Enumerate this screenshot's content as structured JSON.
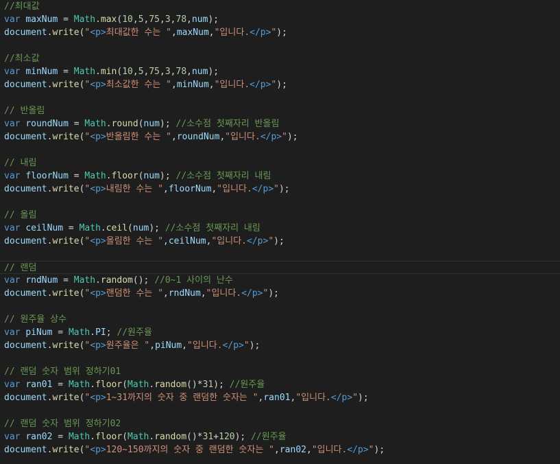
{
  "editor": {
    "current_line": 20,
    "lines": [
      [
        [
          "comment",
          "//최대값"
        ]
      ],
      [
        [
          "keyword",
          "var"
        ],
        [
          "plain",
          " "
        ],
        [
          "variable",
          "maxNum"
        ],
        [
          "plain",
          " = "
        ],
        [
          "class",
          "Math"
        ],
        [
          "plain",
          "."
        ],
        [
          "func",
          "max"
        ],
        [
          "plain",
          "("
        ],
        [
          "number",
          "10"
        ],
        [
          "plain",
          ","
        ],
        [
          "number",
          "5"
        ],
        [
          "plain",
          ","
        ],
        [
          "number",
          "75"
        ],
        [
          "plain",
          ","
        ],
        [
          "number",
          "3"
        ],
        [
          "plain",
          ","
        ],
        [
          "number",
          "78"
        ],
        [
          "plain",
          ","
        ],
        [
          "variable",
          "num"
        ],
        [
          "plain",
          ");"
        ]
      ],
      [
        [
          "variable",
          "document"
        ],
        [
          "plain",
          "."
        ],
        [
          "func",
          "write"
        ],
        [
          "plain",
          "("
        ],
        [
          "string",
          "\""
        ],
        [
          "tag",
          "<p>"
        ],
        [
          "string",
          "최대값한 수는 \""
        ],
        [
          "plain",
          ","
        ],
        [
          "variable",
          "maxNum"
        ],
        [
          "plain",
          ","
        ],
        [
          "string",
          "\"입니다."
        ],
        [
          "tag",
          "</p>"
        ],
        [
          "string",
          "\""
        ],
        [
          "plain",
          ");"
        ]
      ],
      [],
      [
        [
          "comment",
          "//최소값"
        ]
      ],
      [
        [
          "keyword",
          "var"
        ],
        [
          "plain",
          " "
        ],
        [
          "variable",
          "minNum"
        ],
        [
          "plain",
          " = "
        ],
        [
          "class",
          "Math"
        ],
        [
          "plain",
          "."
        ],
        [
          "func",
          "min"
        ],
        [
          "plain",
          "("
        ],
        [
          "number",
          "10"
        ],
        [
          "plain",
          ","
        ],
        [
          "number",
          "5"
        ],
        [
          "plain",
          ","
        ],
        [
          "number",
          "75"
        ],
        [
          "plain",
          ","
        ],
        [
          "number",
          "3"
        ],
        [
          "plain",
          ","
        ],
        [
          "number",
          "78"
        ],
        [
          "plain",
          ","
        ],
        [
          "variable",
          "num"
        ],
        [
          "plain",
          ");"
        ]
      ],
      [
        [
          "variable",
          "document"
        ],
        [
          "plain",
          "."
        ],
        [
          "func",
          "write"
        ],
        [
          "plain",
          "("
        ],
        [
          "string",
          "\""
        ],
        [
          "tag",
          "<p>"
        ],
        [
          "string",
          "최소값한 수는 \""
        ],
        [
          "plain",
          ","
        ],
        [
          "variable",
          "minNum"
        ],
        [
          "plain",
          ","
        ],
        [
          "string",
          "\"입니다."
        ],
        [
          "tag",
          "</p>"
        ],
        [
          "string",
          "\""
        ],
        [
          "plain",
          ");"
        ]
      ],
      [],
      [
        [
          "comment",
          "// 반올림"
        ]
      ],
      [
        [
          "keyword",
          "var"
        ],
        [
          "plain",
          " "
        ],
        [
          "variable",
          "roundNum"
        ],
        [
          "plain",
          " = "
        ],
        [
          "class",
          "Math"
        ],
        [
          "plain",
          "."
        ],
        [
          "func",
          "round"
        ],
        [
          "plain",
          "("
        ],
        [
          "variable",
          "num"
        ],
        [
          "plain",
          "); "
        ],
        [
          "comment",
          "//소수점 첫째자리 반올림"
        ]
      ],
      [
        [
          "variable",
          "document"
        ],
        [
          "plain",
          "."
        ],
        [
          "func",
          "write"
        ],
        [
          "plain",
          "("
        ],
        [
          "string",
          "\""
        ],
        [
          "tag",
          "<p>"
        ],
        [
          "string",
          "반올림한 수는 \""
        ],
        [
          "plain",
          ","
        ],
        [
          "variable",
          "roundNum"
        ],
        [
          "plain",
          ","
        ],
        [
          "string",
          "\"입니다."
        ],
        [
          "tag",
          "</p>"
        ],
        [
          "string",
          "\""
        ],
        [
          "plain",
          ");"
        ]
      ],
      [],
      [
        [
          "comment",
          "// 내림"
        ]
      ],
      [
        [
          "keyword",
          "var"
        ],
        [
          "plain",
          " "
        ],
        [
          "variable",
          "floorNum"
        ],
        [
          "plain",
          " = "
        ],
        [
          "class",
          "Math"
        ],
        [
          "plain",
          "."
        ],
        [
          "func",
          "floor"
        ],
        [
          "plain",
          "("
        ],
        [
          "variable",
          "num"
        ],
        [
          "plain",
          "); "
        ],
        [
          "comment",
          "//소수점 첫째자리 내림"
        ]
      ],
      [
        [
          "variable",
          "document"
        ],
        [
          "plain",
          "."
        ],
        [
          "func",
          "write"
        ],
        [
          "plain",
          "("
        ],
        [
          "string",
          "\""
        ],
        [
          "tag",
          "<p>"
        ],
        [
          "string",
          "내림한 수는 \""
        ],
        [
          "plain",
          ","
        ],
        [
          "variable",
          "floorNum"
        ],
        [
          "plain",
          ","
        ],
        [
          "string",
          "\"입니다."
        ],
        [
          "tag",
          "</p>"
        ],
        [
          "string",
          "\""
        ],
        [
          "plain",
          ");"
        ]
      ],
      [],
      [
        [
          "comment",
          "// 올림"
        ]
      ],
      [
        [
          "keyword",
          "var"
        ],
        [
          "plain",
          " "
        ],
        [
          "variable",
          "ceilNum"
        ],
        [
          "plain",
          " = "
        ],
        [
          "class",
          "Math"
        ],
        [
          "plain",
          "."
        ],
        [
          "func",
          "ceil"
        ],
        [
          "plain",
          "("
        ],
        [
          "variable",
          "num"
        ],
        [
          "plain",
          "); "
        ],
        [
          "comment",
          "//소수점 첫째자리 내림"
        ]
      ],
      [
        [
          "variable",
          "document"
        ],
        [
          "plain",
          "."
        ],
        [
          "func",
          "write"
        ],
        [
          "plain",
          "("
        ],
        [
          "string",
          "\""
        ],
        [
          "tag",
          "<p>"
        ],
        [
          "string",
          "올림한 수는 \""
        ],
        [
          "plain",
          ","
        ],
        [
          "variable",
          "ceilNum"
        ],
        [
          "plain",
          ","
        ],
        [
          "string",
          "\"입니다."
        ],
        [
          "tag",
          "</p>"
        ],
        [
          "string",
          "\""
        ],
        [
          "plain",
          ");"
        ]
      ],
      [],
      [
        [
          "comment",
          "// 랜덤"
        ]
      ],
      [
        [
          "keyword",
          "var"
        ],
        [
          "plain",
          " "
        ],
        [
          "variable",
          "rndNum"
        ],
        [
          "plain",
          " = "
        ],
        [
          "class",
          "Math"
        ],
        [
          "plain",
          "."
        ],
        [
          "func",
          "random"
        ],
        [
          "plain",
          "(); "
        ],
        [
          "comment",
          "//0~1 사이의 난수"
        ]
      ],
      [
        [
          "variable",
          "document"
        ],
        [
          "plain",
          "."
        ],
        [
          "func",
          "write"
        ],
        [
          "plain",
          "("
        ],
        [
          "string",
          "\""
        ],
        [
          "tag",
          "<p>"
        ],
        [
          "string",
          "랜덤한 수는 \""
        ],
        [
          "plain",
          ","
        ],
        [
          "variable",
          "rndNum"
        ],
        [
          "plain",
          ","
        ],
        [
          "string",
          "\"입니다."
        ],
        [
          "tag",
          "</p>"
        ],
        [
          "string",
          "\""
        ],
        [
          "plain",
          ");"
        ]
      ],
      [],
      [
        [
          "comment",
          "// 원주율 상수"
        ]
      ],
      [
        [
          "keyword",
          "var"
        ],
        [
          "plain",
          " "
        ],
        [
          "variable",
          "piNum"
        ],
        [
          "plain",
          " = "
        ],
        [
          "class",
          "Math"
        ],
        [
          "plain",
          "."
        ],
        [
          "variable",
          "PI"
        ],
        [
          "plain",
          "; "
        ],
        [
          "comment",
          "//원주율"
        ]
      ],
      [
        [
          "variable",
          "document"
        ],
        [
          "plain",
          "."
        ],
        [
          "func",
          "write"
        ],
        [
          "plain",
          "("
        ],
        [
          "string",
          "\""
        ],
        [
          "tag",
          "<p>"
        ],
        [
          "string",
          "원주율은 \""
        ],
        [
          "plain",
          ","
        ],
        [
          "variable",
          "piNum"
        ],
        [
          "plain",
          ","
        ],
        [
          "string",
          "\"입니다."
        ],
        [
          "tag",
          "</p>"
        ],
        [
          "string",
          "\""
        ],
        [
          "plain",
          ");"
        ]
      ],
      [],
      [
        [
          "comment",
          "// 랜덤 숫자 범위 정하기01"
        ]
      ],
      [
        [
          "keyword",
          "var"
        ],
        [
          "plain",
          " "
        ],
        [
          "variable",
          "ran01"
        ],
        [
          "plain",
          " = "
        ],
        [
          "class",
          "Math"
        ],
        [
          "plain",
          "."
        ],
        [
          "func",
          "floor"
        ],
        [
          "plain",
          "("
        ],
        [
          "class",
          "Math"
        ],
        [
          "plain",
          "."
        ],
        [
          "func",
          "random"
        ],
        [
          "plain",
          "()*"
        ],
        [
          "number",
          "31"
        ],
        [
          "plain",
          "); "
        ],
        [
          "comment",
          "//원주율"
        ]
      ],
      [
        [
          "variable",
          "document"
        ],
        [
          "plain",
          "."
        ],
        [
          "func",
          "write"
        ],
        [
          "plain",
          "("
        ],
        [
          "string",
          "\""
        ],
        [
          "tag",
          "<p>"
        ],
        [
          "string",
          "1~31까지의 숫자 중 랜덤한 숫자는 \""
        ],
        [
          "plain",
          ","
        ],
        [
          "variable",
          "ran01"
        ],
        [
          "plain",
          ","
        ],
        [
          "string",
          "\"입니다."
        ],
        [
          "tag",
          "</p>"
        ],
        [
          "string",
          "\""
        ],
        [
          "plain",
          ");"
        ]
      ],
      [],
      [
        [
          "comment",
          "// 랜덤 숫자 범위 정하기02"
        ]
      ],
      [
        [
          "keyword",
          "var"
        ],
        [
          "plain",
          " "
        ],
        [
          "variable",
          "ran02"
        ],
        [
          "plain",
          " = "
        ],
        [
          "class",
          "Math"
        ],
        [
          "plain",
          "."
        ],
        [
          "func",
          "floor"
        ],
        [
          "plain",
          "("
        ],
        [
          "class",
          "Math"
        ],
        [
          "plain",
          "."
        ],
        [
          "func",
          "random"
        ],
        [
          "plain",
          "()*"
        ],
        [
          "number",
          "31"
        ],
        [
          "plain",
          "+"
        ],
        [
          "number",
          "120"
        ],
        [
          "plain",
          "); "
        ],
        [
          "comment",
          "//원주율"
        ]
      ],
      [
        [
          "variable",
          "document"
        ],
        [
          "plain",
          "."
        ],
        [
          "func",
          "write"
        ],
        [
          "plain",
          "("
        ],
        [
          "string",
          "\""
        ],
        [
          "tag",
          "<p>"
        ],
        [
          "string",
          "120~150까지의 숫자 중 랜덤한 숫자는 \""
        ],
        [
          "plain",
          ","
        ],
        [
          "variable",
          "ran02"
        ],
        [
          "plain",
          ","
        ],
        [
          "string",
          "\"입니다."
        ],
        [
          "tag",
          "</p>"
        ],
        [
          "string",
          "\""
        ],
        [
          "plain",
          ");"
        ]
      ]
    ]
  }
}
